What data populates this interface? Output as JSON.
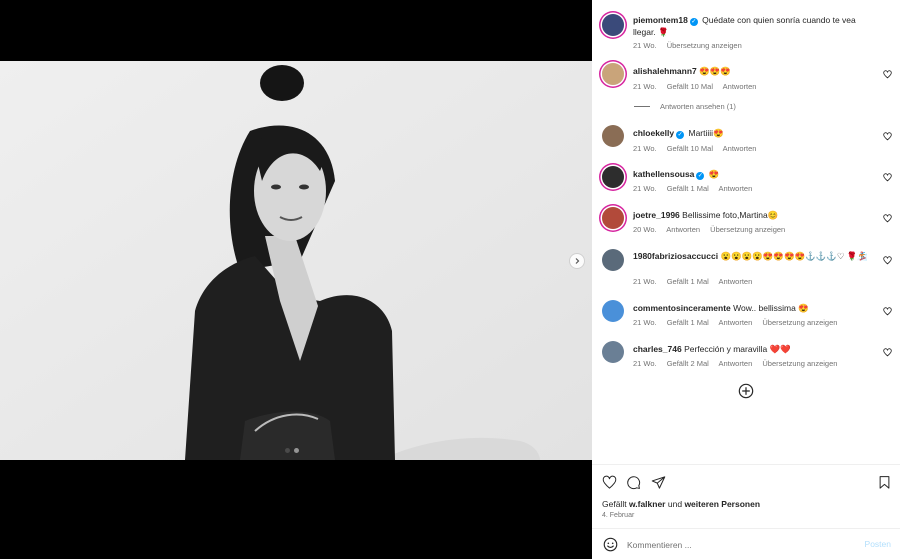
{
  "post": {
    "author": "piemontem18",
    "caption": "Quédate con quien sonría cuando te vea llegar. 🌹",
    "caption_time": "21 Wo.",
    "caption_translate": "Übersetzung anzeigen"
  },
  "comments": [
    {
      "user": "alishalehmann7",
      "verified": false,
      "text": "😍😍😍",
      "time": "21 Wo.",
      "likes": "Gefällt 10 Mal",
      "reply": "Antworten",
      "translate": ""
    },
    {
      "user": "chloekelly",
      "verified": true,
      "text": "Martiiii😍",
      "time": "21 Wo.",
      "likes": "Gefällt 10 Mal",
      "reply": "Antworten",
      "translate": ""
    },
    {
      "user": "kathellensousa",
      "verified": true,
      "text": "😍",
      "time": "21 Wo.",
      "likes": "Gefällt 1 Mal",
      "reply": "Antworten",
      "translate": ""
    },
    {
      "user": "joetre_1996",
      "verified": false,
      "text": "Bellissime foto,Martina😊",
      "time": "20 Wo.",
      "likes": "",
      "reply": "Antworten",
      "translate": "Übersetzung anzeigen"
    },
    {
      "user": "1980fabriziosaccucci",
      "verified": false,
      "text": "😮😮😮😮😍😍😍😍⚓⚓⚓♡ 🌹🏂",
      "time": "21 Wo.",
      "likes": "Gefällt 1 Mal",
      "reply": "Antworten",
      "translate": ""
    },
    {
      "user": "commentosinceramente",
      "verified": false,
      "text": "Wow.. bellissima 😍",
      "time": "21 Wo.",
      "likes": "Gefällt 1 Mal",
      "reply": "Antworten",
      "translate": "Übersetzung anzeigen"
    },
    {
      "user": "charles_746",
      "verified": false,
      "text": "Perfección y maravilla ❤️❤️",
      "time": "21 Wo.",
      "likes": "Gefällt 2 Mal",
      "reply": "Antworten",
      "translate": "Übersetzung anzeigen"
    }
  ],
  "replies_toggle": "Antworten ansehen (1)",
  "likes_summary": {
    "prefix": "Gefällt",
    "user": "w.falkner",
    "middle": "und",
    "others": "weiteren Personen"
  },
  "post_date": "4. Februar",
  "composer": {
    "placeholder": "Kommentieren ...",
    "post_label": "Posten"
  },
  "icons": {
    "next": "chevron-right-icon",
    "like": "heart-icon",
    "comment": "comment-bubble-icon",
    "share": "paper-plane-icon",
    "save": "bookmark-icon",
    "emoji": "smiley-icon",
    "load_more": "plus-circle-icon"
  },
  "carousel": {
    "total": 2,
    "active": 1
  },
  "colors": {
    "verified": "#0095f6",
    "post_button": "#b2dffc",
    "story_ring": "#d6249f"
  }
}
